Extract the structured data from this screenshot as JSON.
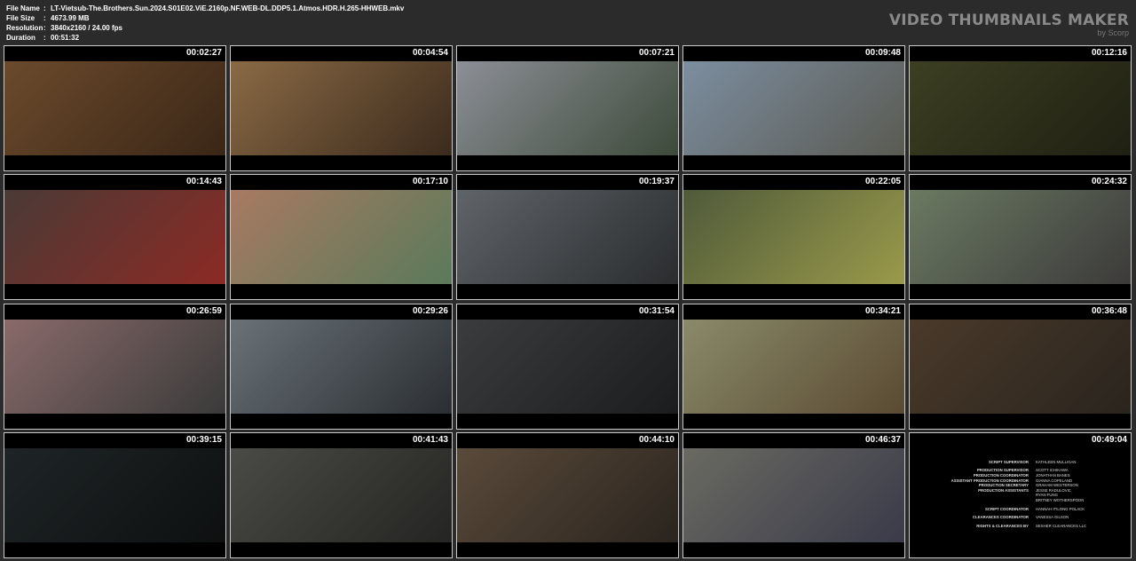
{
  "file_info": [
    {
      "key": "File Name",
      "value": "LT-Vietsub-The.Brothers.Sun.2024.S01E02.ViE.2160p.NF.WEB-DL.DDP5.1.Atmos.HDR.H.265-HHWEB.mkv"
    },
    {
      "key": "File Size",
      "value": "4673.99 MB"
    },
    {
      "key": "Resolution",
      "value": "3840x2160 / 24.00 fps"
    },
    {
      "key": "Duration",
      "value": "00:51:32"
    }
  ],
  "separator": ":",
  "brand": {
    "title": "VIDEO THUMBNAILS MAKER",
    "subtitle": "by Scorp"
  },
  "thumbnails": [
    {
      "time": "00:02:27",
      "colors": [
        "#6b4a2c",
        "#3a2616"
      ]
    },
    {
      "time": "00:04:54",
      "colors": [
        "#8a6a45",
        "#3b2a1c"
      ]
    },
    {
      "time": "00:07:21",
      "colors": [
        "#8c8f96",
        "#3d4a3a"
      ]
    },
    {
      "time": "00:09:48",
      "colors": [
        "#7c8ea0",
        "#5a5a52"
      ]
    },
    {
      "time": "00:12:16",
      "colors": [
        "#3c3f22",
        "#1f2012"
      ]
    },
    {
      "time": "00:14:43",
      "colors": [
        "#4a3a36",
        "#8c2a24"
      ]
    },
    {
      "time": "00:17:10",
      "colors": [
        "#a87a62",
        "#5a7a5a"
      ]
    },
    {
      "time": "00:19:37",
      "colors": [
        "#5f6468",
        "#2a2c2e"
      ]
    },
    {
      "time": "00:22:05",
      "colors": [
        "#4f5a3a",
        "#9a9a4a"
      ]
    },
    {
      "time": "00:24:32",
      "colors": [
        "#6a7a62",
        "#3c3a3a"
      ]
    },
    {
      "time": "00:26:59",
      "colors": [
        "#8a6a6a",
        "#3a3a3a"
      ]
    },
    {
      "time": "00:29:26",
      "colors": [
        "#6a7278",
        "#2a2e32"
      ]
    },
    {
      "time": "00:31:54",
      "colors": [
        "#3a3c3e",
        "#1a1c1e"
      ]
    },
    {
      "time": "00:34:21",
      "colors": [
        "#8a8a6a",
        "#5a4a32"
      ]
    },
    {
      "time": "00:36:48",
      "colors": [
        "#4a3a2a",
        "#2a241e"
      ]
    },
    {
      "time": "00:39:15",
      "colors": [
        "#1e2426",
        "#0e1010"
      ]
    },
    {
      "time": "00:41:43",
      "colors": [
        "#4a4a46",
        "#242422"
      ]
    },
    {
      "time": "00:44:10",
      "colors": [
        "#5a4a3a",
        "#2a241e"
      ]
    },
    {
      "time": "00:46:37",
      "colors": [
        "#6a6a62",
        "#3a3a4a"
      ]
    },
    {
      "time": "00:49:04",
      "colors": [
        "#000000",
        "#000000"
      ],
      "credits": [
        {
          "role": "SCRIPT SUPERVISOR",
          "name": "KATHLEEN MULLIGAN"
        },
        {
          "role": "",
          "name": ""
        },
        {
          "role": "PRODUCTION SUPERVISOR",
          "name": "SCOTT ICHIKAWA"
        },
        {
          "role": "PRODUCTION COORDINATOR",
          "name": "JONATHAN BANES"
        },
        {
          "role": "ASSISTANT PRODUCTION COORDINATOR",
          "name": "GIANNA COPELAND"
        },
        {
          "role": "PRODUCTION SECRETARY",
          "name": "GRAHAM WESTERSON"
        },
        {
          "role": "PRODUCTION ASSISTANTS",
          "name": "JESSE RADULOVIC"
        },
        {
          "role": "",
          "name": "RYAN FUNG"
        },
        {
          "role": "",
          "name": "BRITNEY WOTHERSPOON"
        },
        {
          "role": "",
          "name": ""
        },
        {
          "role": "SCRIPT COORDINATOR",
          "name": "HANNAH ITILONG POLACK"
        },
        {
          "role": "",
          "name": ""
        },
        {
          "role": "CLEARANCES COORDINATOR",
          "name": "VANESSA GILSON"
        },
        {
          "role": "",
          "name": ""
        },
        {
          "role": "RIGHTS & CLEARANCES BY",
          "name": "SESHER CLEARANCES LLC"
        }
      ]
    }
  ]
}
